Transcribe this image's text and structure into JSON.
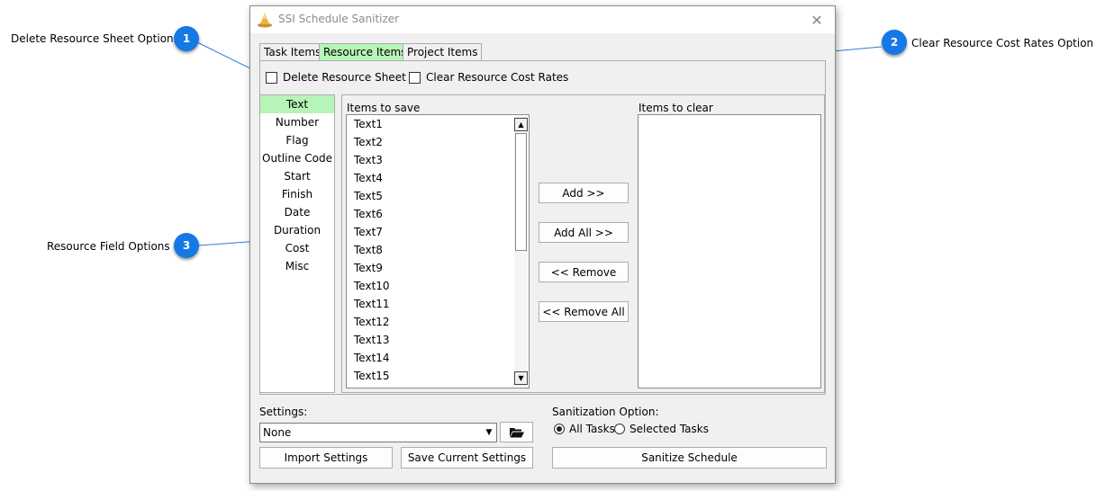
{
  "callouts": [
    {
      "number": "1",
      "label": "Delete Resource Sheet Option"
    },
    {
      "number": "2",
      "label": "Clear Resource Cost Rates Option"
    },
    {
      "number": "3",
      "label": "Resource Field Options"
    }
  ],
  "window": {
    "title": "SSI Schedule Sanitizer",
    "close_glyph": "✕"
  },
  "tabs": [
    {
      "label": "Task Items",
      "active": false
    },
    {
      "label": "Resource Items",
      "active": true
    },
    {
      "label": "Project Items",
      "active": false
    }
  ],
  "options": {
    "delete_resource_sheet": {
      "label": "Delete Resource Sheet",
      "checked": false
    },
    "clear_cost_rates": {
      "label": "Clear Resource Cost Rates",
      "checked": false
    }
  },
  "field_types": [
    "Text",
    "Number",
    "Flag",
    "Outline Code",
    "Start",
    "Finish",
    "Date",
    "Duration",
    "Cost",
    "Misc"
  ],
  "selected_field_type": "Text",
  "items_to_save": {
    "label": "Items to save",
    "items": [
      "Text1",
      "Text2",
      "Text3",
      "Text4",
      "Text5",
      "Text6",
      "Text7",
      "Text8",
      "Text9",
      "Text10",
      "Text11",
      "Text12",
      "Text13",
      "Text14",
      "Text15"
    ]
  },
  "items_to_clear": {
    "label": "Items to clear",
    "items": []
  },
  "transfer_buttons": {
    "add": "Add >>",
    "add_all": "Add All >>",
    "remove": "<< Remove",
    "remove_all": "<< Remove All"
  },
  "settings": {
    "label": "Settings:",
    "selected": "None",
    "import_label": "Import Settings",
    "save_label": "Save Current Settings"
  },
  "sanitization": {
    "label": "Sanitization Option:",
    "all_tasks": "All Tasks",
    "selected_tasks": "Selected Tasks",
    "selected": "All Tasks",
    "run_label": "Sanitize Schedule"
  },
  "colors": {
    "accent_green": "#b7f4b7",
    "callout_blue": "#1478e6",
    "callout_line": "#2b7fd6"
  }
}
